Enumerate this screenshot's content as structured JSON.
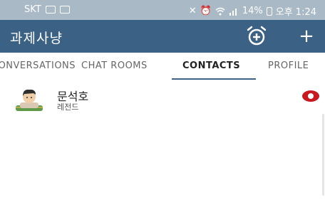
{
  "status_bar": {
    "carrier": "SKT",
    "battery": "14%",
    "time": "오후 1:24"
  },
  "app_bar": {
    "title": "과제사냥"
  },
  "tabs": [
    {
      "label": "CONVERSATIONS",
      "active": false
    },
    {
      "label": "CHAT ROOMS",
      "active": false
    },
    {
      "label": "CONTACTS",
      "active": true
    },
    {
      "label": "PROFILE",
      "active": false
    }
  ],
  "contacts": [
    {
      "name": "문석호",
      "status": "레전드",
      "presence_color": "#c81820"
    }
  ],
  "colors": {
    "app_bar": "#3b6184",
    "status_bar": "#aab9c6",
    "presence": "#c81820"
  }
}
